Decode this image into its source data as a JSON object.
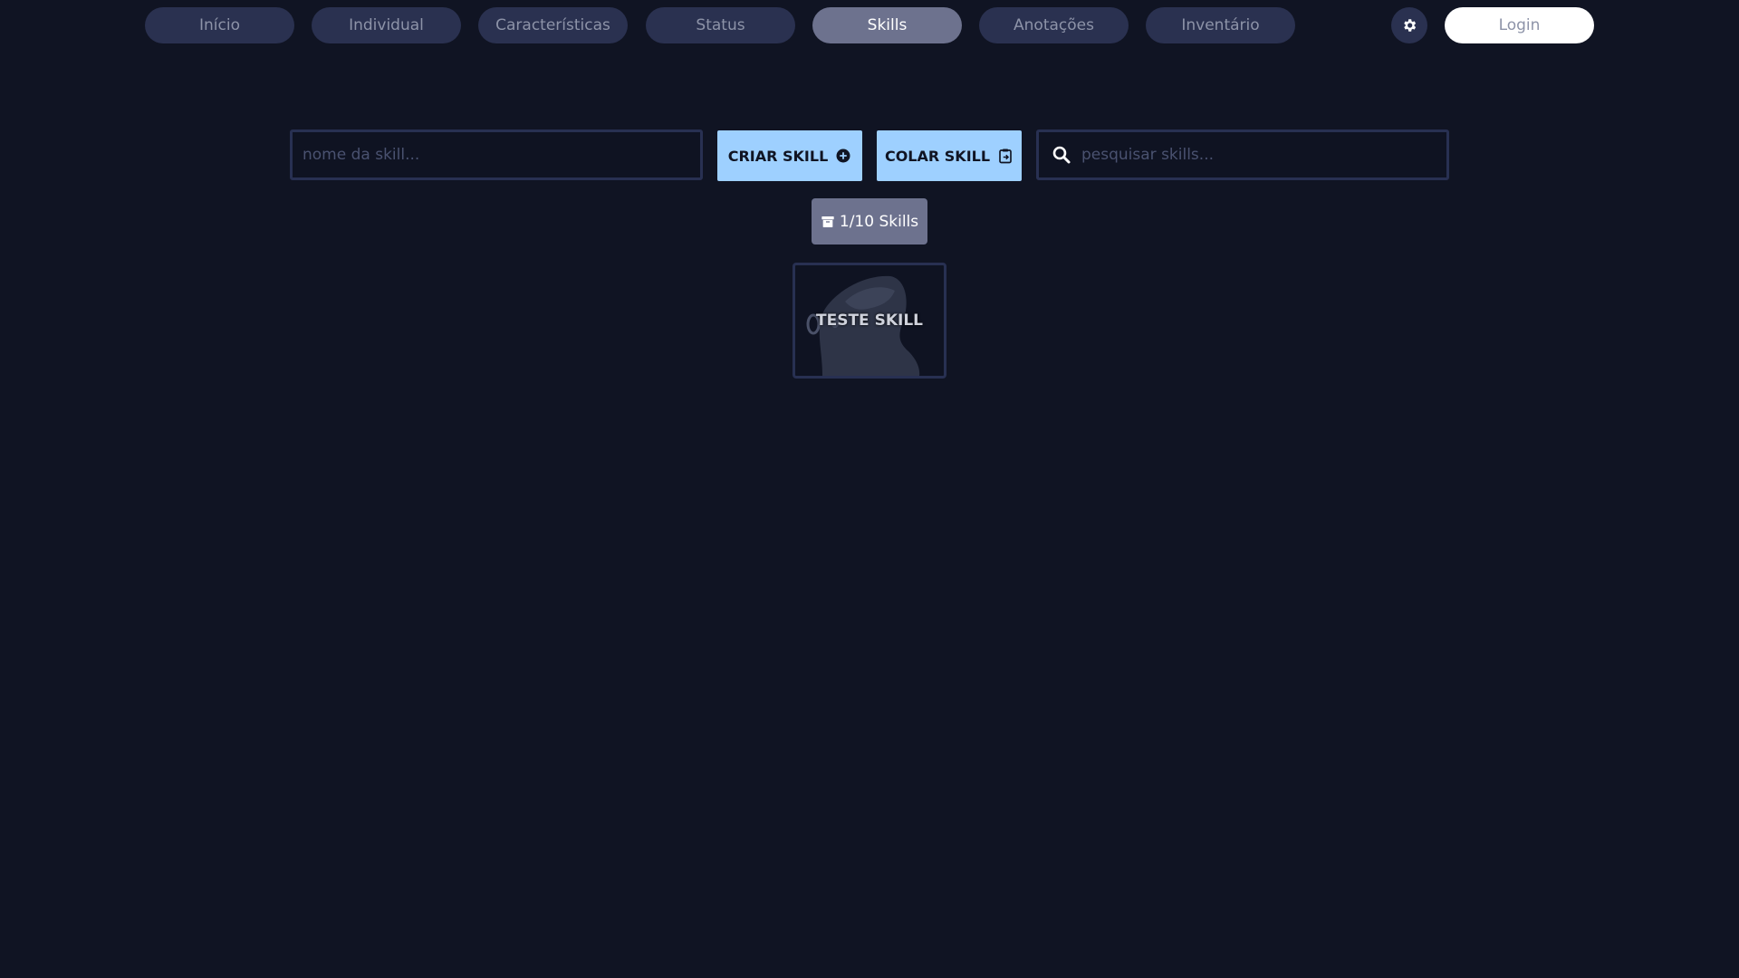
{
  "nav": {
    "tabs": [
      {
        "label": "Início"
      },
      {
        "label": "Individual"
      },
      {
        "label": "Características"
      },
      {
        "label": "Status"
      },
      {
        "label": "Skills",
        "active": true
      },
      {
        "label": "Anotações"
      },
      {
        "label": "Inventário"
      }
    ],
    "settings_icon": "gear-icon",
    "login_label": "Login"
  },
  "toolbar": {
    "name_input": {
      "placeholder": "nome da skill...",
      "value": ""
    },
    "create_label": "CRIAR SKILL",
    "create_icon": "plus-circle-icon",
    "paste_label": "COLAR SKILL",
    "paste_icon": "clipboard-icon",
    "search_input": {
      "placeholder": "pesquisar skills...",
      "value": ""
    },
    "search_icon": "search-icon"
  },
  "skill_count": {
    "label": "1/10 Skills",
    "icon": "archive-icon"
  },
  "skills": [
    {
      "title": "TESTE SKILL"
    }
  ],
  "colors": {
    "background": "#101423",
    "tab": "#2a3150",
    "tab_active": "#6d728e",
    "accent": "#9ed0ff"
  }
}
